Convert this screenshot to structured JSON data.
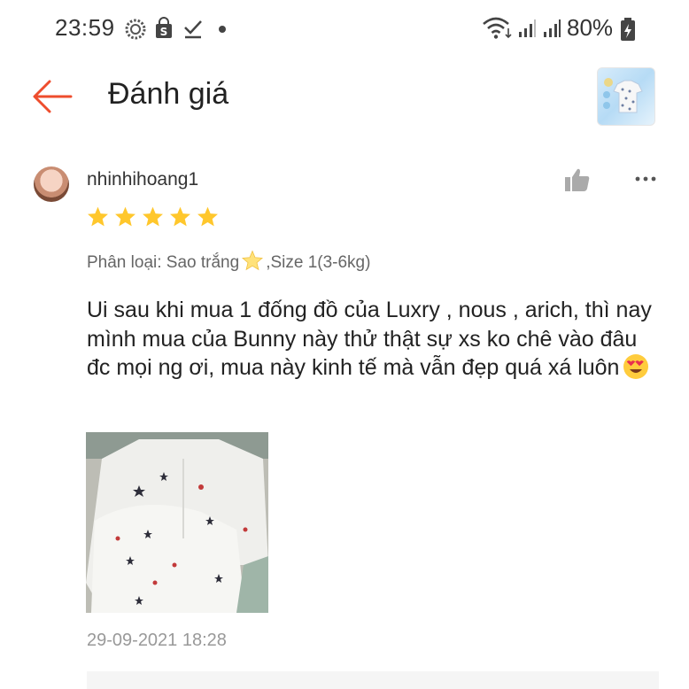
{
  "status_bar": {
    "time": "23:59",
    "battery_percent": "80%",
    "icons": [
      "settings-gear-icon",
      "shopee-bag-icon",
      "check-download-icon",
      "dot-icon",
      "wifi-icon",
      "signal-icon",
      "signal-icon",
      "battery-charging-icon"
    ]
  },
  "header": {
    "back_icon": "arrow-left-icon",
    "title": "Đánh giá",
    "accent_color": "#ee4d2d"
  },
  "review": {
    "username": "nhinhihoang1",
    "rating": 5,
    "rating_max": 5,
    "star_color": "#ffc72c",
    "variant": "Phân loại: Sao trắng ⭐,Size 1(3-6kg)",
    "variant_prefix": "Phân loại: Sao trắng",
    "variant_suffix": ",Size 1(3-6kg)",
    "text": "Ui sau khi mua 1 đống đồ của Luxry , nous , arich, thì nay mình mua của Bunny này thử thật sự xs ko chê vào đâu đc mọi ng ơi, mua này kinh tế mà vẫn đẹp quá xá luôn",
    "text_emoji": "heart-eyes-emoji",
    "timestamp": "29-09-2021 18:28",
    "actions": [
      "thumbs-up-icon",
      "more-options-icon"
    ]
  }
}
